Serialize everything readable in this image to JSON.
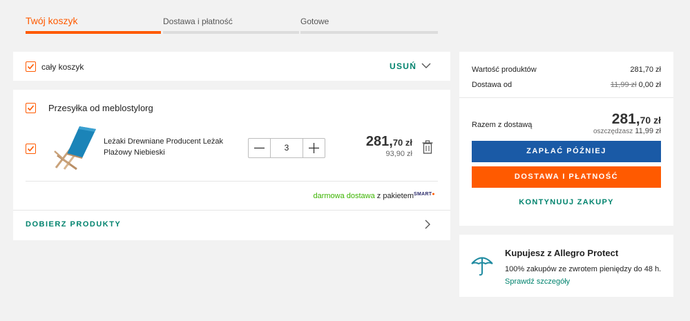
{
  "steps": [
    {
      "label": "Twój koszyk"
    },
    {
      "label": "Dostawa i płatność"
    },
    {
      "label": "Gotowe"
    }
  ],
  "cart": {
    "select_all_label": "cały koszyk",
    "remove_label": "USUŃ",
    "seller_label": "Przesyłka od meblostylorg",
    "item": {
      "name": "Leżaki Drewniane Producent Leżak Plażowy Niebieski",
      "quantity": "3",
      "price_main": "281,",
      "price_cents": "70 zł",
      "unit_price": "93,90 zł"
    },
    "shipping_free": "darmowa dostawa",
    "shipping_suffix": " z pakietem",
    "smart_badge": "SMART",
    "more_products": "DOBIERZ PRODUKTY"
  },
  "summary": {
    "products_label": "Wartość produktów",
    "products_value": "281,70 zł",
    "shipping_label": "Dostawa od",
    "shipping_old": "11,99 zł",
    "shipping_value": "0,00 zł",
    "total_label": "Razem z dostawą",
    "total_main": "281,",
    "total_cents": "70 zł",
    "savings_label": "oszczędzasz",
    "savings_value": "11,99 zł",
    "pay_later": "ZAPŁAĆ PÓŹNIEJ",
    "delivery_payment": "DOSTAWA I PŁATNOŚĆ",
    "continue_shopping": "KONTYNUUJ ZAKUPY"
  },
  "protect": {
    "title": "Kupujesz z Allegro Protect",
    "text": "100% zakupów ze zwrotem pieniędzy do 48 h.",
    "link": "Sprawdź szczegóły"
  },
  "colors": {
    "accent": "#ff5a00",
    "link": "#00836e",
    "pay_later": "#1a5aa6",
    "free_shipping": "#3bb400"
  }
}
